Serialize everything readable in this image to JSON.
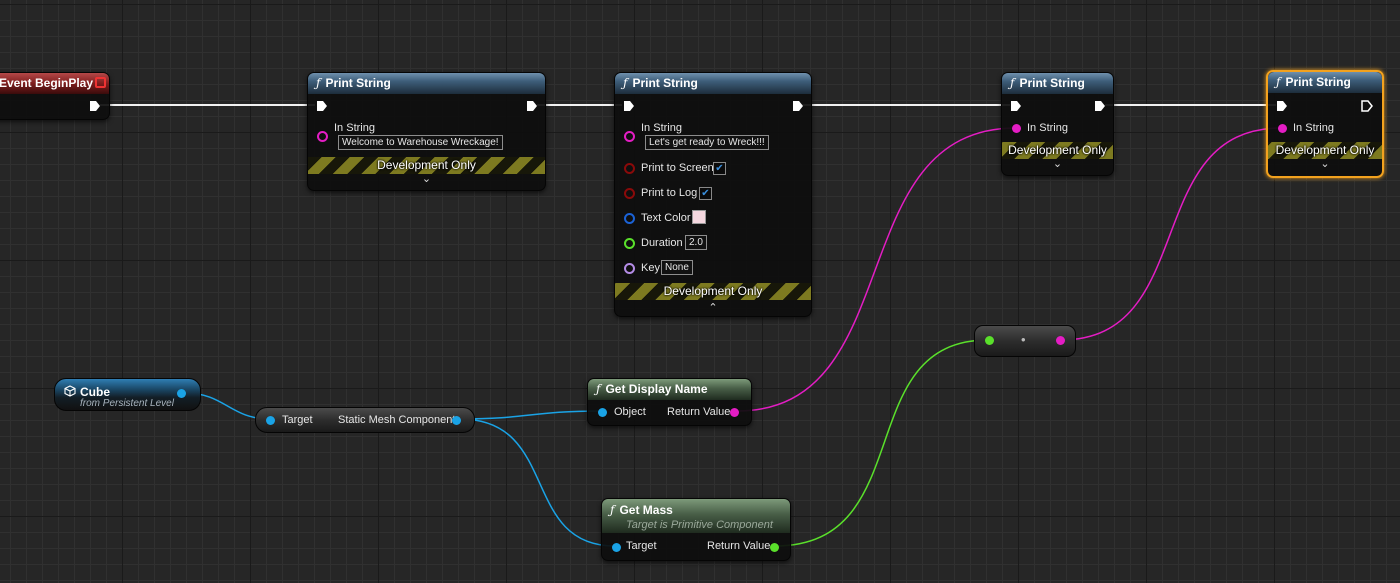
{
  "graph": {
    "event_begin_play": {
      "title": "Event BeginPlay"
    },
    "print_string_1": {
      "title": "Print String",
      "in_string_label": "In String",
      "in_string_value": "Welcome to Warehouse Wreckage!",
      "dev_only": "Development Only"
    },
    "print_string_2": {
      "title": "Print String",
      "in_string_label": "In String",
      "in_string_value": "Let's get ready to Wreck!!!",
      "print_to_screen_label": "Print to Screen",
      "print_to_screen": true,
      "print_to_log_label": "Print to Log",
      "print_to_log": true,
      "text_color_label": "Text Color",
      "text_color": "#f5d8e0",
      "duration_label": "Duration",
      "duration_value": "2.0",
      "key_label": "Key",
      "key_value": "None",
      "dev_only": "Development Only"
    },
    "print_string_3": {
      "title": "Print String",
      "in_string_label": "In String",
      "dev_only": "Development Only"
    },
    "print_string_4": {
      "title": "Print String",
      "in_string_label": "In String",
      "dev_only": "Development Only"
    },
    "cube": {
      "title": "Cube",
      "subtitle": "from Persistent Level"
    },
    "static_mesh": {
      "target_label": "Target",
      "output_label": "Static Mesh Component"
    },
    "get_display_name": {
      "title": "Get Display Name",
      "object_label": "Object",
      "return_label": "Return Value"
    },
    "get_mass": {
      "title": "Get Mass",
      "subtitle": "Target is Primitive Component",
      "target_label": "Target",
      "return_label": "Return Value"
    },
    "conversion": {
      "center_glyph": "•"
    },
    "icons": {
      "function": "ƒ",
      "chevron_down": "⌄",
      "chevron_up": "⌃",
      "check": "✔"
    }
  },
  "colors": {
    "exec_wire": "#ffffff",
    "object_pin": "#1aa3e6",
    "string_pin": "#e41dc4",
    "float_pin": "#5ae02b",
    "bool_pin": "#8a0a0a",
    "struct_pin": "#1b62d6",
    "name_pin": "#b48ce6",
    "selection": "#f3a21e"
  }
}
